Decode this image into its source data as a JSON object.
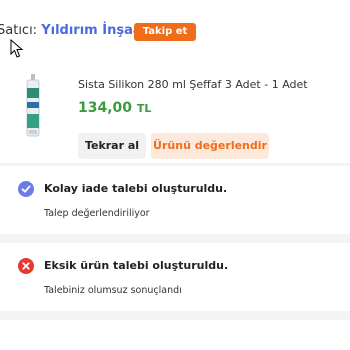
{
  "seller": {
    "prefix": "Satıcı:",
    "name": "Yıldırım İnşaat",
    "follow_label": "Takip et"
  },
  "product": {
    "title": "Sista Silikon 280 ml Şeffaf 3 Adet - 1 Adet",
    "price": "134,00",
    "currency": "TL",
    "rebuy_label": "Tekrar al",
    "review_label": "Ürünü değerlendir"
  },
  "status_cards": [
    {
      "icon": "check-circle-icon",
      "title": "Kolay iade talebi oluşturuldu.",
      "subtitle": "Talep değerlendiriliyor"
    },
    {
      "icon": "error-circle-icon",
      "title": "Eksik ürün talebi oluşturuldu.",
      "subtitle": "Talebiniz olumsuz sonuçlandı"
    }
  ],
  "colors": {
    "accent": "#ef6d1a",
    "seller_link": "#4b6bdb",
    "price": "#3c9a3c",
    "success": "#6b7be8",
    "error": "#e53935"
  }
}
